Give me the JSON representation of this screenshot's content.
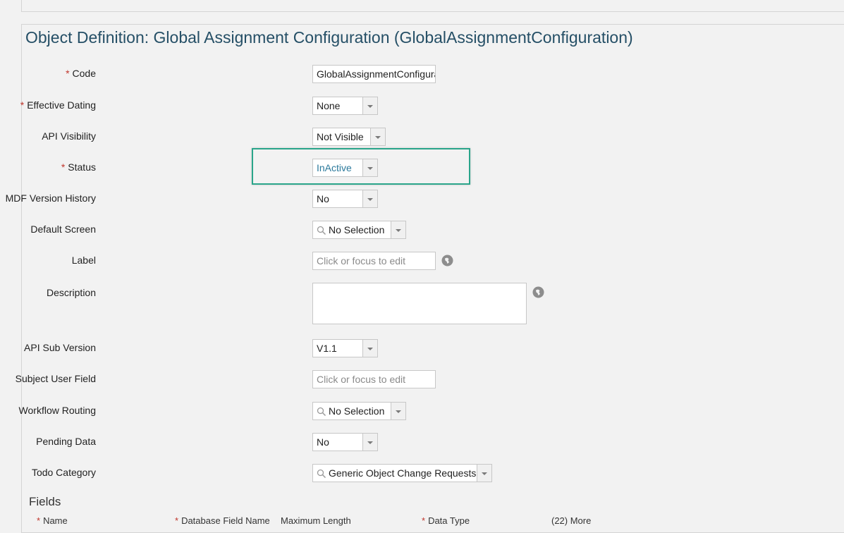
{
  "page_title": "Object Definition: Global Assignment Configuration (GlobalAssignmentConfiguration)",
  "fields": {
    "code": {
      "label": "Code",
      "required": "*",
      "value": "GlobalAssignmentConfigurat"
    },
    "effective_dating": {
      "label": "Effective Dating",
      "required": "*",
      "value": "None"
    },
    "api_visibility": {
      "label": "API Visibility",
      "value": "Not Visible"
    },
    "status": {
      "label": "Status",
      "required": "*",
      "value": "InActive"
    },
    "mdf_version_history": {
      "label": "MDF Version History",
      "value": "No"
    },
    "default_screen": {
      "label": "Default Screen",
      "value": "No Selection"
    },
    "label": {
      "label": "Label",
      "placeholder": "Click or focus to edit"
    },
    "description": {
      "label": "Description",
      "value": ""
    },
    "api_sub_version": {
      "label": "API Sub Version",
      "value": "V1.1"
    },
    "subject_user_field": {
      "label": "Subject User Field",
      "placeholder": "Click or focus to edit"
    },
    "workflow_routing": {
      "label": "Workflow Routing",
      "value": "No Selection"
    },
    "pending_data": {
      "label": "Pending Data",
      "value": "No"
    },
    "todo_category": {
      "label": "Todo Category",
      "value": "Generic Object Change Requests"
    }
  },
  "fields_section": {
    "title": "Fields",
    "columns": [
      "Name",
      "Database Field Name",
      "Maximum Length",
      "Data Type",
      "(22) More"
    ],
    "required_marker": "*"
  },
  "icons": {
    "dropdown": "chevron-down-icon",
    "search": "search-icon",
    "translation": "globe-icon"
  },
  "colors": {
    "title": "#254f66",
    "required": "#c0362c",
    "highlight": "#2aa58a",
    "status_value": "#2c7a9c"
  }
}
